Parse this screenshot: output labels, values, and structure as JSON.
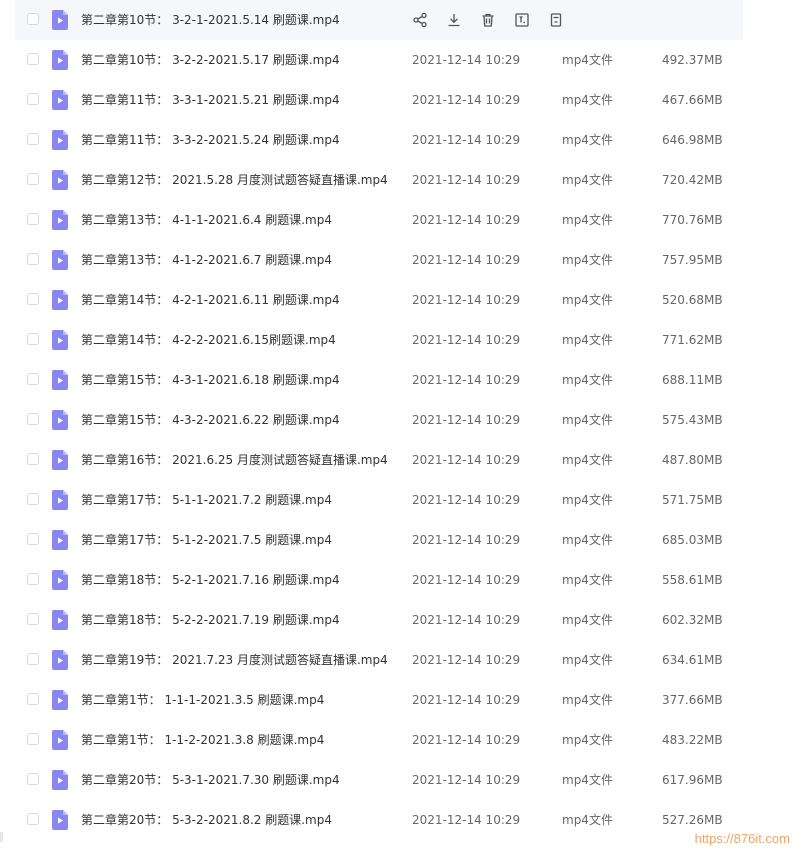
{
  "file_list": {
    "type_label": "mp4文件",
    "date_value": "2021-12-14 10:29",
    "rows": [
      {
        "name": "第二章第10节： 3-2-1-2021.5.14 刷题课.mp4",
        "size": ""
      },
      {
        "name": "第二章第10节： 3-2-2-2021.5.17 刷题课.mp4",
        "size": "492.37MB"
      },
      {
        "name": "第二章第11节： 3-3-1-2021.5.21 刷题课.mp4",
        "size": "467.66MB"
      },
      {
        "name": "第二章第11节： 3-3-2-2021.5.24 刷题课.mp4",
        "size": "646.98MB"
      },
      {
        "name": "第二章第12节： 2021.5.28 月度测试题答疑直播课.mp4",
        "size": "720.42MB"
      },
      {
        "name": "第二章第13节： 4-1-1-2021.6.4 刷题课.mp4",
        "size": "770.76MB"
      },
      {
        "name": "第二章第13节： 4-1-2-2021.6.7 刷题课.mp4",
        "size": "757.95MB"
      },
      {
        "name": "第二章第14节： 4-2-1-2021.6.11 刷题课.mp4",
        "size": "520.68MB"
      },
      {
        "name": "第二章第14节： 4-2-2-2021.6.15刷题课.mp4",
        "size": "771.62MB"
      },
      {
        "name": "第二章第15节： 4-3-1-2021.6.18 刷题课.mp4",
        "size": "688.11MB"
      },
      {
        "name": "第二章第15节： 4-3-2-2021.6.22 刷题课.mp4",
        "size": "575.43MB"
      },
      {
        "name": "第二章第16节： 2021.6.25 月度测试题答疑直播课.mp4",
        "size": "487.80MB"
      },
      {
        "name": "第二章第17节： 5-1-1-2021.7.2 刷题课.mp4",
        "size": "571.75MB"
      },
      {
        "name": "第二章第17节： 5-1-2-2021.7.5 刷题课.mp4",
        "size": "685.03MB"
      },
      {
        "name": "第二章第18节： 5-2-1-2021.7.16 刷题课.mp4",
        "size": "558.61MB"
      },
      {
        "name": "第二章第18节： 5-2-2-2021.7.19 刷题课.mp4",
        "size": "602.32MB"
      },
      {
        "name": "第二章第19节： 2021.7.23 月度测试题答疑直播课.mp4",
        "size": "634.61MB"
      },
      {
        "name": "第二章第1节： 1-1-1-2021.3.5 刷题课.mp4",
        "size": "377.66MB"
      },
      {
        "name": "第二章第1节： 1-1-2-2021.3.8 刷题课.mp4",
        "size": "483.22MB"
      },
      {
        "name": "第二章第20节： 5-3-1-2021.7.30 刷题课.mp4",
        "size": "617.96MB"
      },
      {
        "name": "第二章第20节： 5-3-2-2021.8.2 刷题课.mp4",
        "size": "527.26MB"
      }
    ],
    "hover_actions": [
      {
        "name": "share-icon"
      },
      {
        "name": "download-icon"
      },
      {
        "name": "delete-icon"
      },
      {
        "name": "rename-icon"
      },
      {
        "name": "more-icon"
      }
    ]
  },
  "colors": {
    "video_icon": "#8a87f2",
    "video_icon_fold": "#b9b6fb",
    "action_icon": "#555555",
    "watermark": "#f0a46a"
  },
  "watermark": {
    "text": "https://876it.com"
  }
}
